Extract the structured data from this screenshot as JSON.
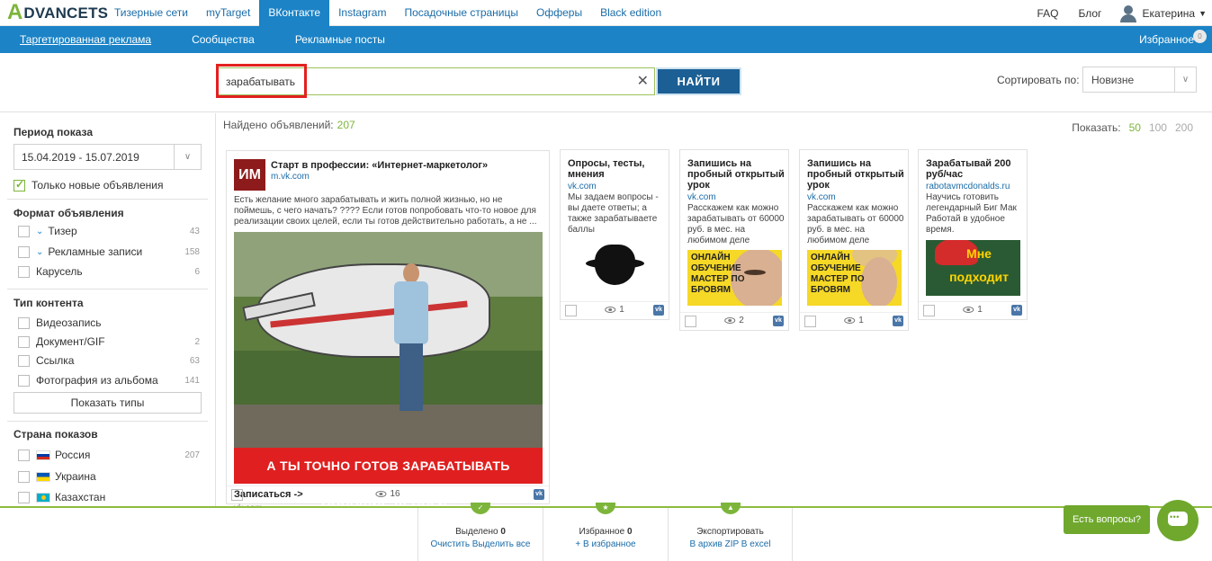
{
  "brand": {
    "logo_mark": "A",
    "logo_text": "DVANCETS",
    "accent": "#7cb53a",
    "nav_blue": "#1b83c6"
  },
  "topnav": [
    "Тизерные сети",
    "myTarget",
    "ВКонтакте",
    "Instagram",
    "Посадочные страницы",
    "Офферы",
    "Black edition"
  ],
  "topnav_active": "ВКонтакте",
  "top_right": {
    "faq": "FAQ",
    "blog": "Блог",
    "user": "Екатерина"
  },
  "subnav": [
    "Таргетированная реклама",
    "Сообщества",
    "Рекламные посты"
  ],
  "subnav_active": "Таргетированная реклама",
  "favorites": {
    "label": "Избранное",
    "count": "0"
  },
  "search": {
    "value": "зарабатывать",
    "button": "НАЙТИ"
  },
  "sort": {
    "label": "Сортировать по:",
    "value": "Новизне"
  },
  "sidebar": {
    "period_title": "Период показа",
    "period_value": "15.04.2019 - 15.07.2019",
    "only_new": "Только новые объявления",
    "format_title": "Формат объявления",
    "formats": [
      {
        "label": "Тизер",
        "count": "43"
      },
      {
        "label": "Рекламные записи",
        "count": "158"
      },
      {
        "label": "Карусель",
        "count": "6"
      }
    ],
    "content_title": "Тип контента",
    "content": [
      {
        "label": "Видеозапись",
        "count": ""
      },
      {
        "label": "Документ/GIF",
        "count": "2"
      },
      {
        "label": "Ссылка",
        "count": "63"
      },
      {
        "label": "Фотография из альбома",
        "count": "141"
      }
    ],
    "show_types": "Показать типы",
    "country_title": "Страна показов",
    "countries": [
      {
        "label": "Россия",
        "count": "207"
      },
      {
        "label": "Украина",
        "count": ""
      },
      {
        "label": "Казахстан",
        "count": ""
      }
    ]
  },
  "results": {
    "found_label": "Найдено объявлений:",
    "found_count": "207",
    "show_label": "Показать:",
    "page_sizes": [
      "50",
      "100",
      "200"
    ],
    "page_size_active": "50"
  },
  "cards": {
    "big": {
      "avatar": "ИМ",
      "title": "Старт в профессии: «Интернет-маркетолог»",
      "domain": "m.vk.com",
      "text": "Есть желание много зарабатывать и жить полной жизнью, но не поймешь, с чего начать? ???? Если готов попробовать что-то новое для реализации своих целей, если ты готов действительно работать, а не ...",
      "banner": "А ТЫ ТОЧНО ГОТОВ ЗАРАБАТЫВАТЬ БОЛЬШИЕ ДЕНЬГИ?",
      "cta": "Записаться ->",
      "cta_domain": "vk.com",
      "views": "16"
    },
    "c2": {
      "title": "Опросы, тесты, мнения",
      "domain": "vk.com",
      "text": "Мы задаем вопросы - вы даете ответы; а также зарабатываете баллы",
      "views": "1"
    },
    "c3": {
      "title": "Запишись на пробный открытый урок",
      "domain": "vk.com",
      "text": "Расскажем как можно зарабатывать от 60000 руб. в мес. на любимом деле",
      "img_text": "ОНЛАЙН ОБУЧЕНИЕ МАСТЕР ПО БРОВЯМ",
      "views": "2"
    },
    "c4": {
      "title": "Запишись на пробный открытый урок",
      "domain": "vk.com",
      "text": "Расскажем как можно зарабатывать от 60000 руб. в мес. на любимом деле",
      "img_text": "ОНЛАЙН ОБУЧЕНИЕ МАСТЕР ПО БРОВЯМ",
      "views": "1"
    },
    "c5": {
      "title": "Зарабатывай 200 руб/час",
      "domain": "rabotavmcdonalds.ru",
      "text": "Научись готовить легендарный Биг Мак Работай в удобное время.",
      "img_text": "Мне подходит график",
      "views": "1"
    }
  },
  "bottom": {
    "selected_label": "Выделено",
    "selected_count": "0",
    "selected_actions": "Очистить Выделить все",
    "fav_label": "Избранное",
    "fav_count": "0",
    "fav_action": "+ В избранное",
    "export_label": "Экспортировать",
    "export_action": "В архив ZIP В excel"
  },
  "questions": "Есть вопросы?"
}
